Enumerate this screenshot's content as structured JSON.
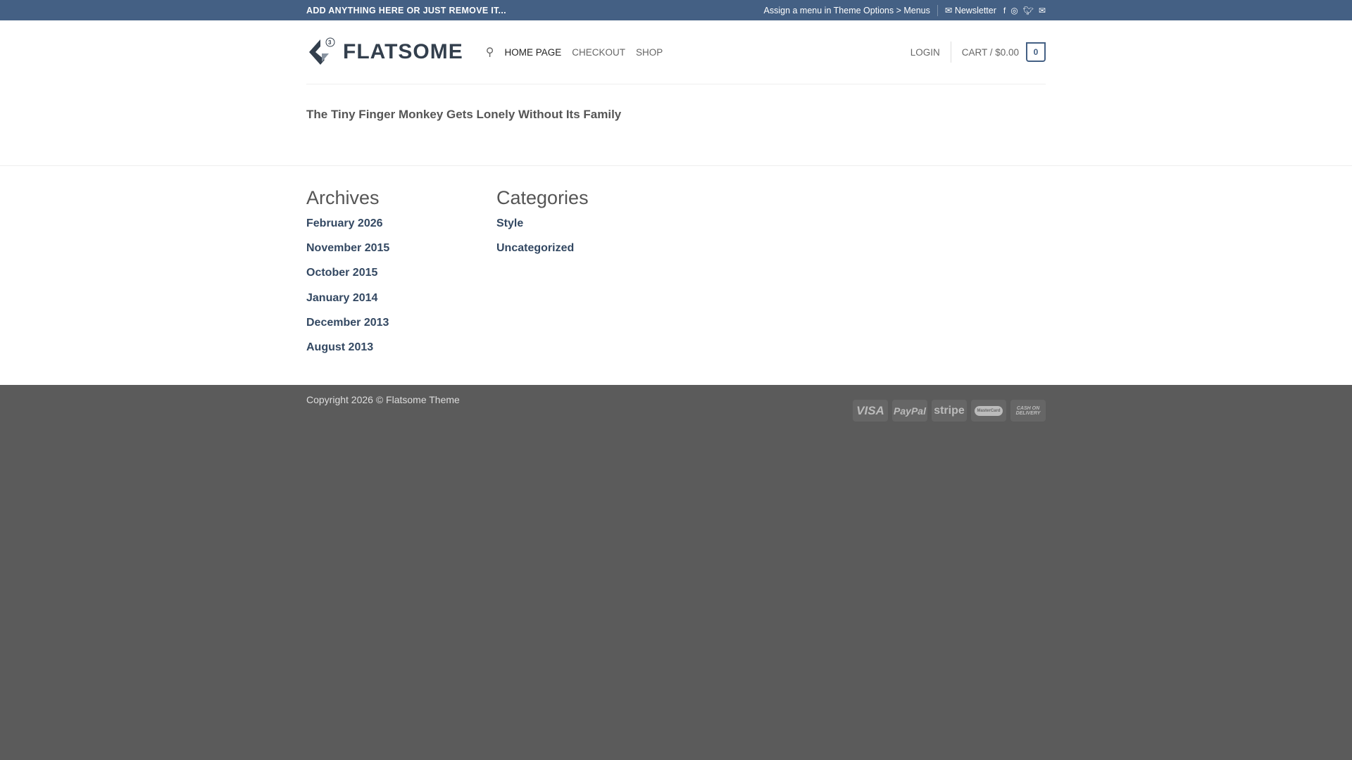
{
  "topbar": {
    "left": "ADD ANYTHING HERE OR JUST REMOVE IT...",
    "menu_hint": "Assign a menu in Theme Options > Menus",
    "newsletter": "Newsletter"
  },
  "header": {
    "logo": "FLATSOME",
    "logo_badge": "3",
    "nav": [
      "HOME PAGE",
      "CHECKOUT",
      "SHOP"
    ],
    "login": "LOGIN",
    "cart": "CART / $0.00",
    "cart_count": "0"
  },
  "page": {
    "title": "The Tiny Finger Monkey Gets Lonely Without Its Family"
  },
  "archives": {
    "heading": "Archives",
    "items": [
      "February 2026",
      "November 2015",
      "October 2015",
      "January 2014",
      "December 2013",
      "August 2013"
    ]
  },
  "categories": {
    "heading": "Categories",
    "items": [
      "Style",
      "Uncategorized"
    ]
  },
  "footer": {
    "copyright": "Copyright 2026 © Flatsome Theme",
    "payments": [
      "VISA",
      "PayPal",
      "stripe",
      "MasterCard",
      "CASH ON DELIVERY"
    ]
  }
}
